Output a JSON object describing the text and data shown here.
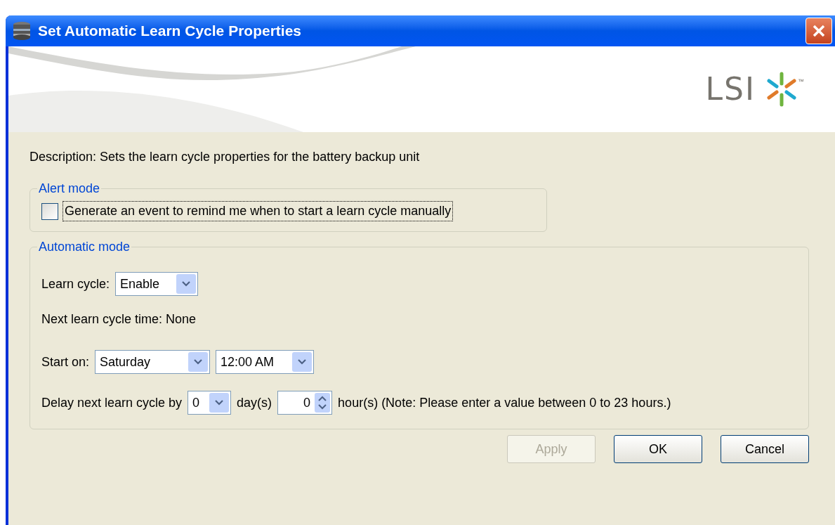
{
  "window": {
    "title": "Set Automatic Learn Cycle Properties"
  },
  "logo": {
    "text": "LSI",
    "mark": "™"
  },
  "description": "Description: Sets the learn cycle properties for the battery backup unit",
  "alert_mode": {
    "legend": "Alert mode",
    "checkbox": {
      "label": "Generate an event to remind me when to start a learn cycle manually",
      "checked": false
    }
  },
  "automatic_mode": {
    "legend": "Automatic mode",
    "learn_cycle": {
      "label": "Learn cycle:",
      "value": "Enable"
    },
    "next_time": "Next learn cycle time: None",
    "start_on": {
      "label": "Start on:",
      "day": "Saturday",
      "time": "12:00 AM"
    },
    "delay": {
      "label": "Delay next learn cycle by",
      "days": "0",
      "days_unit": "day(s)",
      "hours": "0",
      "hours_unit": "hour(s) (Note: Please enter a value between 0 to 23 hours.)"
    }
  },
  "buttons": [
    {
      "label": "Apply",
      "disabled": true
    },
    {
      "label": "OK",
      "disabled": false
    },
    {
      "label": "Cancel",
      "disabled": false
    }
  ]
}
